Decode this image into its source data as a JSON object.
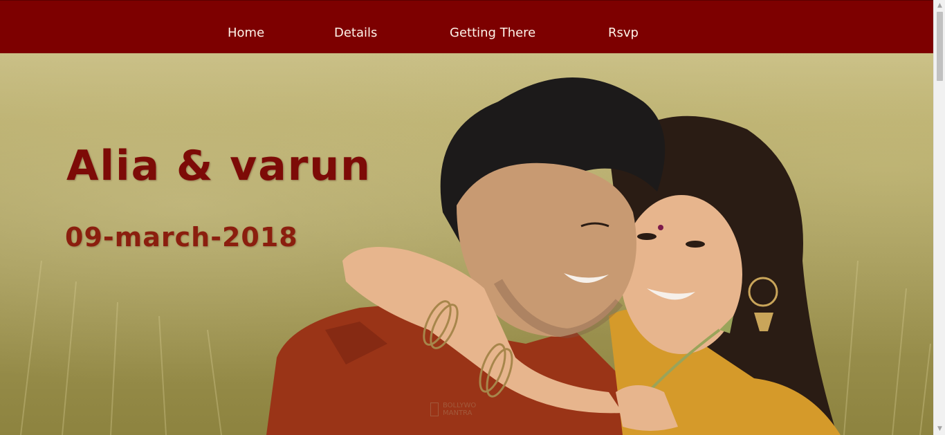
{
  "nav": {
    "items": [
      {
        "label": "Home"
      },
      {
        "label": "Details"
      },
      {
        "label": "Getting There"
      },
      {
        "label": "Rsvp"
      }
    ]
  },
  "hero": {
    "title": "Alia & varun",
    "date": "09-march-2018",
    "watermark": {
      "line1": "BOLLYWO",
      "line2": "MANTRA"
    }
  },
  "colors": {
    "nav_background": "#7d0000",
    "nav_text": "#fff4ea",
    "title_color": "#7d0b07",
    "date_color": "#8b1e0e"
  },
  "icons": {
    "scroll_up": "chevron-up-icon",
    "scroll_down": "chevron-down-icon",
    "watermark": "logo-icon"
  }
}
